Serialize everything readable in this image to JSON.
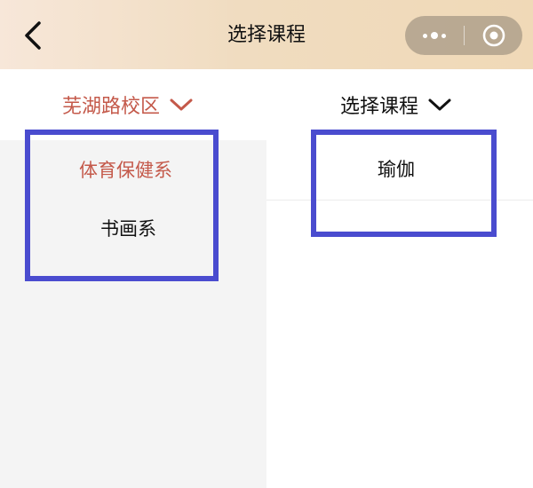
{
  "navbar": {
    "title": "选择课程",
    "back_icon": "chevron-left-icon",
    "more_icon": "more-dots-icon",
    "close_icon": "target-circle-icon",
    "gradient_colors": [
      "#f7e7d9",
      "#f0d9b7"
    ]
  },
  "filters": {
    "campus_label": "芜湖路校区",
    "campus_color": "#c4594a",
    "course_label": "选择课程",
    "chevron_icon": "chevron-down-icon"
  },
  "categories": [
    {
      "label": "体育保健系",
      "selected": true
    },
    {
      "label": "书画系",
      "selected": false
    }
  ],
  "courses": [
    {
      "label": "瑜伽"
    }
  ],
  "colors": {
    "accent": "#c4594a",
    "highlight_box": "#4a4ccf",
    "left_panel_bg": "#f4f4f4"
  }
}
